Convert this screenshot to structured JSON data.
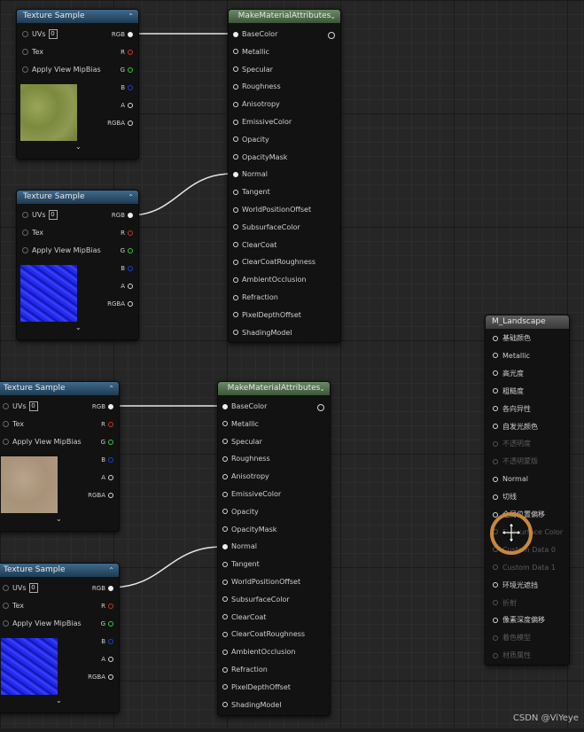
{
  "colors": {
    "texture_header": "#2f5575",
    "material_header": "#55734f",
    "landscape_header": "#4d4d4d",
    "pin_r": "#c0392b",
    "pin_g": "#2ecc40",
    "pin_b": "#1f3fd0",
    "cursor_ring": "#c9873c"
  },
  "texture_sample": {
    "title": "Texture Sample",
    "inputs": [
      "UVs",
      "Tex",
      "Apply View MipBias"
    ],
    "uv_value": "0",
    "outputs": [
      "RGB",
      "R",
      "G",
      "B",
      "A",
      "RGBA"
    ],
    "collapse_icon": "chevron-up-icon",
    "expand_icon": "chevron-down-icon"
  },
  "texture_nodes": [
    {
      "preview": "grass-texture"
    },
    {
      "preview": "blue-normal-map"
    },
    {
      "preview": "sand-texture"
    },
    {
      "preview": "blue-normal-map"
    }
  ],
  "make_material_attributes": {
    "title": "MakeMaterialAttributes",
    "pins": [
      "BaseColor",
      "Metallic",
      "Specular",
      "Roughness",
      "Anisotropy",
      "EmissiveColor",
      "Opacity",
      "OpacityMask",
      "Normal",
      "Tangent",
      "WorldPositionOffset",
      "SubsurfaceColor",
      "ClearCoat",
      "ClearCoatRoughness",
      "AmbientOcclusion",
      "Refraction",
      "PixelDepthOffset",
      "ShadingModel"
    ]
  },
  "landscape": {
    "title": "M_Landscape",
    "pins": [
      {
        "label": "基础颜色",
        "enabled": true
      },
      {
        "label": "Metallic",
        "enabled": true
      },
      {
        "label": "高光度",
        "enabled": true
      },
      {
        "label": "粗糙度",
        "enabled": true
      },
      {
        "label": "各向异性",
        "enabled": true
      },
      {
        "label": "自发光颜色",
        "enabled": true
      },
      {
        "label": "不透明度",
        "enabled": false
      },
      {
        "label": "不透明蒙版",
        "enabled": false
      },
      {
        "label": "Normal",
        "enabled": true
      },
      {
        "label": "切线",
        "enabled": true
      },
      {
        "label": "全局位置偏移",
        "enabled": true
      },
      {
        "label": "Subsurface Color",
        "enabled": false
      },
      {
        "label": "Custom Data 0",
        "enabled": false
      },
      {
        "label": "Custom Data 1",
        "enabled": false
      },
      {
        "label": "环境光遮挡",
        "enabled": true
      },
      {
        "label": "折射",
        "enabled": false
      },
      {
        "label": "像素深度偏移",
        "enabled": true
      },
      {
        "label": "着色模型",
        "enabled": false
      },
      {
        "label": "材质属性",
        "enabled": false
      }
    ]
  },
  "cursor_icon": "move-cursor-icon",
  "watermark": "CSDN @ViYeye"
}
